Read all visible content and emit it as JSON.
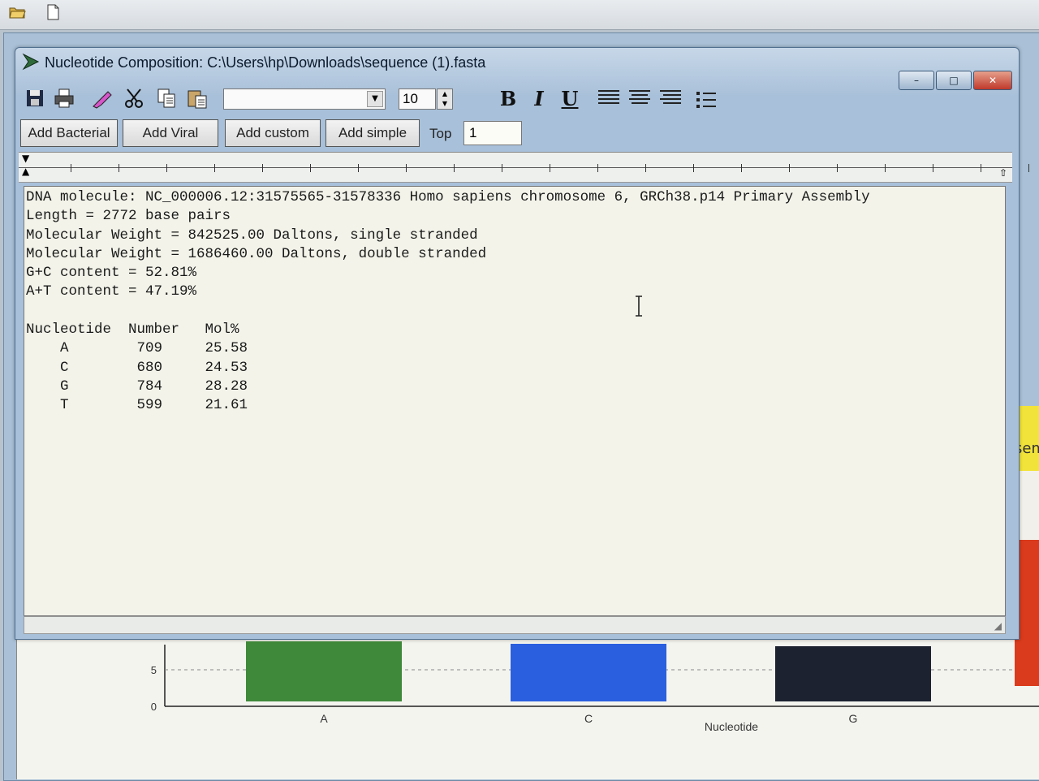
{
  "top_toolbar": {
    "open_icon": "folder-open-icon",
    "new_icon": "new-file-icon"
  },
  "dialog": {
    "title": "Nucleotide Composition: C:\\Users\\hp\\Downloads\\sequence (1).fasta",
    "window_buttons": {
      "minimize": "–",
      "maximize": "□",
      "close": "✕"
    },
    "toolbar": {
      "icons": [
        "save-icon",
        "print-icon",
        "highlighter-icon",
        "cut-icon",
        "copy-icon",
        "paste-icon"
      ],
      "font_name": "",
      "font_size": "10",
      "bold": "B",
      "italic": "I",
      "underline": "U",
      "align_icons": [
        "align-left-icon",
        "align-center-icon",
        "align-right-icon",
        "bullet-list-icon"
      ]
    },
    "buttons": {
      "add_bacterial": "Add Bacterial",
      "add_viral": "Add Viral",
      "add_custom": "Add custom",
      "add_simple": "Add simple",
      "top_label": "Top",
      "top_value": "1"
    },
    "report": {
      "lines": [
        "DNA molecule: NC_000006.12:31575565-31578336 Homo sapiens chromosome 6, GRCh38.p14 Primary Assembly",
        "Length = 2772 base pairs",
        "Molecular Weight = 842525.00 Daltons, single stranded",
        "Molecular Weight = 1686460.00 Daltons, double stranded",
        "G+C content = 52.81%",
        "A+T content = 47.19%",
        "",
        "Nucleotide  Number   Mol%",
        "    A        709     25.58",
        "    C        680     24.53",
        "    G        784     28.28",
        "    T        599     21.61"
      ]
    }
  },
  "background_chart": {
    "right_fragment": "sem",
    "colors": {
      "A": "#3f8a3a",
      "C": "#2a5fe0",
      "G": "#1c2230",
      "T": "#d93b1c"
    },
    "chart_data": {
      "type": "bar",
      "categories": [
        "A",
        "C",
        "G"
      ],
      "xlabel": "Nucleotide",
      "ylabel": "",
      "y_ticks": [
        "0",
        "5"
      ],
      "values": [
        25.58,
        24.53,
        28.28
      ]
    }
  }
}
